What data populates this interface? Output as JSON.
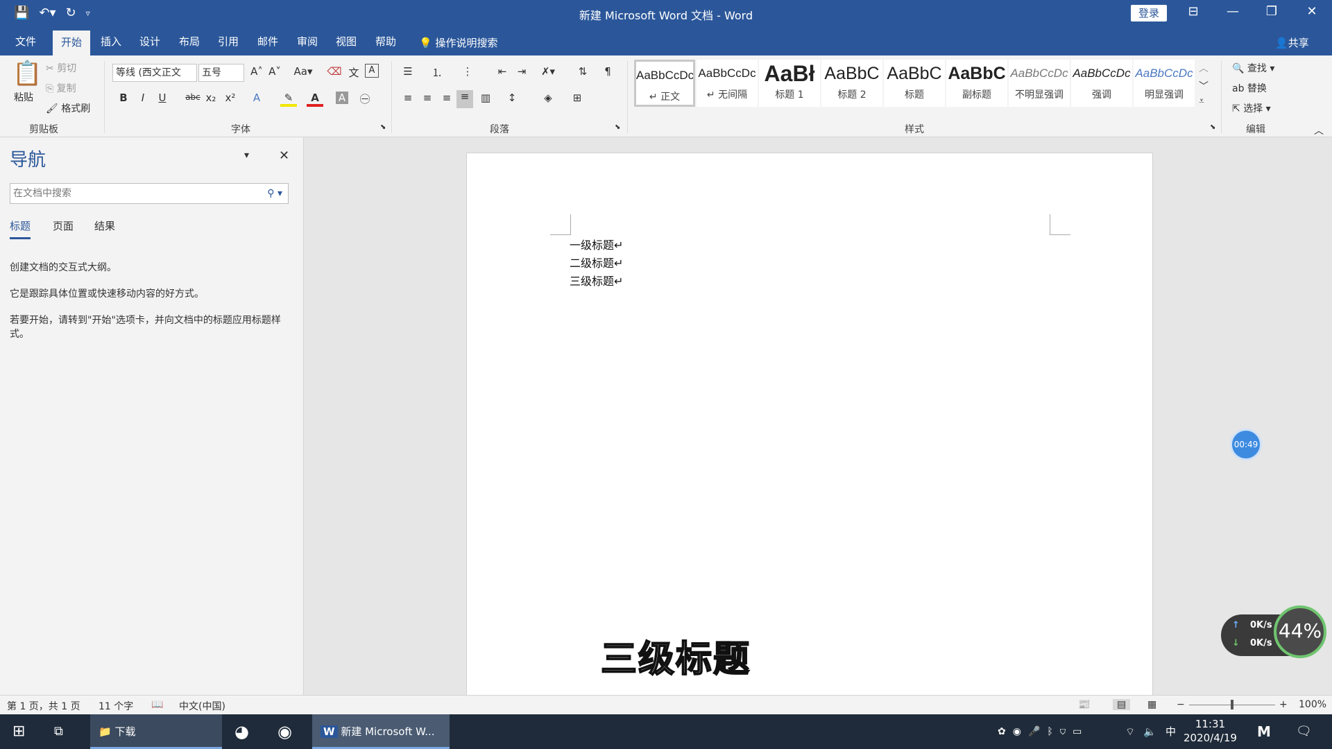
{
  "window": {
    "title": "新建 Microsoft Word 文档 - Word",
    "login": "登录"
  },
  "menu_tabs": [
    "文件",
    "开始",
    "插入",
    "设计",
    "布局",
    "引用",
    "邮件",
    "审阅",
    "视图",
    "帮助"
  ],
  "tell_me": "操作说明搜索",
  "share": "共享",
  "clipboard": {
    "paste": "粘贴",
    "cut": "剪切",
    "copy": "复制",
    "format_painter": "格式刷",
    "label": "剪贴板"
  },
  "font": {
    "name": "等线 (西文正文",
    "size": "五号",
    "label": "字体"
  },
  "paragraph": {
    "label": "段落"
  },
  "styles": {
    "label": "样式",
    "items": [
      {
        "preview": "AaBbCcDc",
        "name": "↵ 正文"
      },
      {
        "preview": "AaBbCcDc",
        "name": "↵ 无间隔"
      },
      {
        "preview": "AaBł",
        "name": "标题 1"
      },
      {
        "preview": "AaBbC",
        "name": "标题 2"
      },
      {
        "preview": "AaBbC",
        "name": "标题"
      },
      {
        "preview": "AaBbC",
        "name": "副标题"
      },
      {
        "preview": "AaBbCcDc",
        "name": "不明显强调"
      },
      {
        "preview": "AaBbCcDc",
        "name": "强调"
      },
      {
        "preview": "AaBbCcDc",
        "name": "明显强调"
      }
    ]
  },
  "editing": {
    "find": "查找",
    "replace": "替换",
    "select": "选择",
    "label": "编辑"
  },
  "nav_pane": {
    "title": "导航",
    "search_placeholder": "在文档中搜索",
    "tabs": [
      "标题",
      "页面",
      "结果"
    ],
    "help": [
      "创建文档的交互式大纲。",
      "它是跟踪具体位置或快速移动内容的好方式。",
      "若要开始，请转到\"开始\"选项卡，并向文档中的标题应用标题样式。"
    ]
  },
  "document": {
    "lines": [
      "一级标题↵",
      "二级标题↵",
      "三级标题↵"
    ]
  },
  "caption": "三级标题",
  "overlay": {
    "timer": "00:49",
    "upload": "0K/s",
    "download": "0K/s",
    "cpu": "44%"
  },
  "status_bar": {
    "page": "第 1 页，共 1 页",
    "words": "11 个字",
    "language": "中文(中国)",
    "zoom": "100%",
    "zoom_level": 1.0
  },
  "taskbar": {
    "downloads": "下载",
    "word": "新建 Microsoft W...",
    "time": "11:31",
    "date": "2020/4/19",
    "ime": "中"
  },
  "colors": {
    "accent": "#2b579a",
    "ribbon": "#f3f3f3"
  }
}
